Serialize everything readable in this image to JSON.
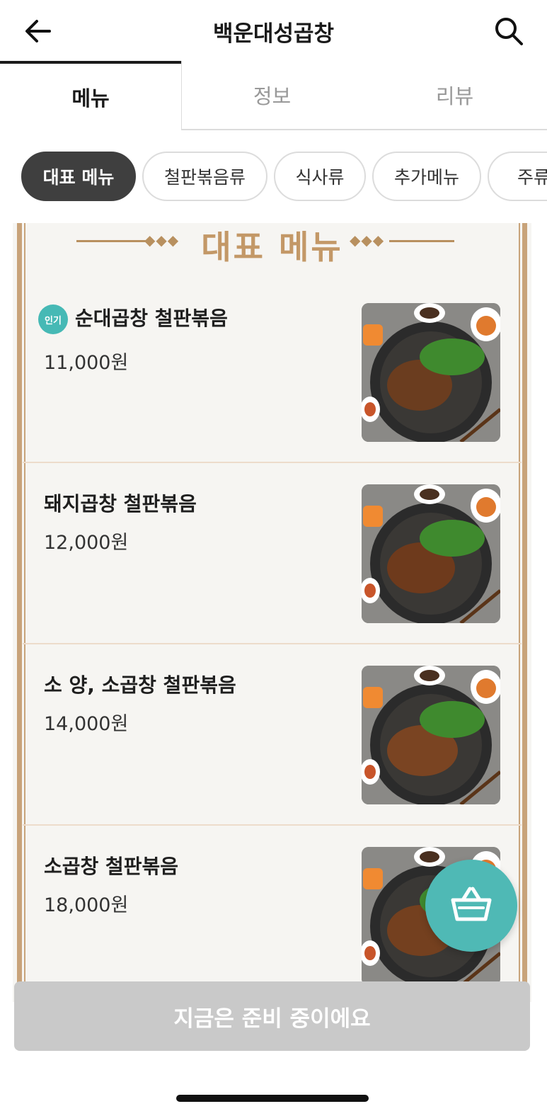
{
  "header": {
    "title": "백운대성곱창"
  },
  "tabs": [
    {
      "label": "메뉴"
    },
    {
      "label": "정보"
    },
    {
      "label": "리뷰"
    }
  ],
  "categories": [
    {
      "label": "대표 메뉴"
    },
    {
      "label": "철판볶음류"
    },
    {
      "label": "식사류"
    },
    {
      "label": "추가메뉴"
    },
    {
      "label": "주류"
    }
  ],
  "section": {
    "title": "대표 메뉴"
  },
  "menu_items": [
    {
      "badge": "인기",
      "name": "순대곱창 철판볶음",
      "price": "11,000원"
    },
    {
      "name": "돼지곱창 철판볶음",
      "price": "12,000원"
    },
    {
      "name": "소 양, 소곱창 철판볶음",
      "price": "14,000원"
    },
    {
      "name": "소곱창 철판볶음",
      "price": "18,000원"
    }
  ],
  "order_button": {
    "label": "지금은 준비 중이에요"
  },
  "colors": {
    "accent": "#4fb9b5",
    "frame": "#c8a37a",
    "disabled": "#c9c9c9"
  }
}
